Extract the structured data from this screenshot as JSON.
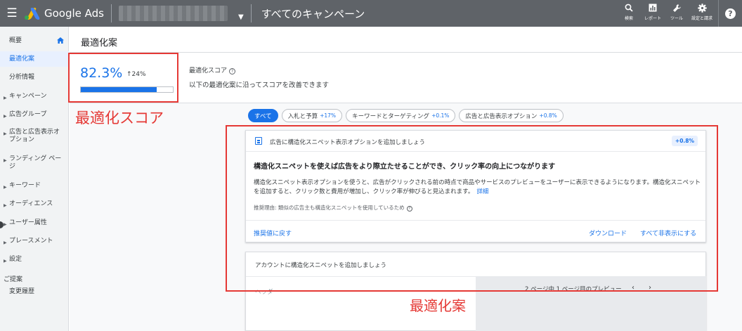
{
  "topbar": {
    "menu_icon": "hamburger-menu-icon",
    "brand": "Google Ads",
    "campaign_title": "すべてのキャンペーン",
    "tools": [
      {
        "icon": "search-icon",
        "label": "検索"
      },
      {
        "icon": "reports-icon",
        "label": "レポート"
      },
      {
        "icon": "wrench-icon",
        "label": "ツール"
      },
      {
        "icon": "gear-icon",
        "label": "設定と請求"
      }
    ],
    "help_icon": "help-icon"
  },
  "sidebar": {
    "items": [
      {
        "label": "概要",
        "expandable": false,
        "active": false
      },
      {
        "label": "最適化案",
        "expandable": false,
        "active": true
      },
      {
        "label": "分析情報",
        "expandable": false,
        "active": false
      },
      {
        "label": "キャンペーン",
        "expandable": true,
        "active": false
      },
      {
        "label": "広告グループ",
        "expandable": true,
        "active": false
      },
      {
        "label": "広告と広告表示オプション",
        "expandable": true,
        "active": false
      },
      {
        "label": "ランディング ページ",
        "expandable": true,
        "active": false
      },
      {
        "label": "キーワード",
        "expandable": true,
        "active": false
      },
      {
        "label": "オーディエンス",
        "expandable": true,
        "active": false
      },
      {
        "label": "ユーザー属性",
        "expandable": true,
        "active": false
      },
      {
        "label": "プレースメント",
        "expandable": true,
        "active": false
      },
      {
        "label": "設定",
        "expandable": true,
        "active": false
      }
    ],
    "section": "ご提案",
    "history": "変更履歴"
  },
  "page": {
    "title": "最適化案"
  },
  "score": {
    "value": "82.3%",
    "delta": "↑24%",
    "fraction": 0.823,
    "label": "最適化スコア",
    "description": "以下の最適化案に沿ってスコアを改善できます"
  },
  "annotations": {
    "score_label": "最適化スコア",
    "recommendation_label": "最適化案",
    "color": "#e53935"
  },
  "filters": [
    {
      "label": "すべて",
      "pct": "",
      "active": true
    },
    {
      "label": "入札と予算",
      "pct": "+17%",
      "active": false
    },
    {
      "label": "キーワードとターゲティング",
      "pct": "+0.1%",
      "active": false
    },
    {
      "label": "広告と広告表示オプション",
      "pct": "+0.8%",
      "active": false
    }
  ],
  "recommendation_card": {
    "header_title": "広告に構造化スニペット表示オプションを追加しましょう",
    "badge": "+0.8%",
    "headline": "構造化スニペットを使えば広告をより際立たせることができ、クリック率の向上につながります",
    "body": "構造化スニペット表示オプションを使うと、広告がクリックされる前の時点で商品やサービスのプレビューをユーザーに表示できるようになります。構造化スニペットを追加すると、クリック数と費用が増加し、クリック率が伸びると見込まれます。",
    "more_link": "詳細",
    "reason": "推奨理由: 類似の広告主も構造化スニペットを使用しているため",
    "back_link": "推奨値に戻す",
    "download_link": "ダウンロード",
    "hide_all_link": "すべて非表示にする"
  },
  "second_card": {
    "title": "アカウントに構造化スニペットを追加しましょう",
    "left_label": "ヘッダー",
    "preview_label": "2 ページ中 1 ページ目のプレビュー",
    "prev_icon": "chevron-left-icon",
    "next_icon": "chevron-right-icon"
  },
  "colors": {
    "accent": "#1a73e8",
    "topbar": "#5f6368"
  }
}
